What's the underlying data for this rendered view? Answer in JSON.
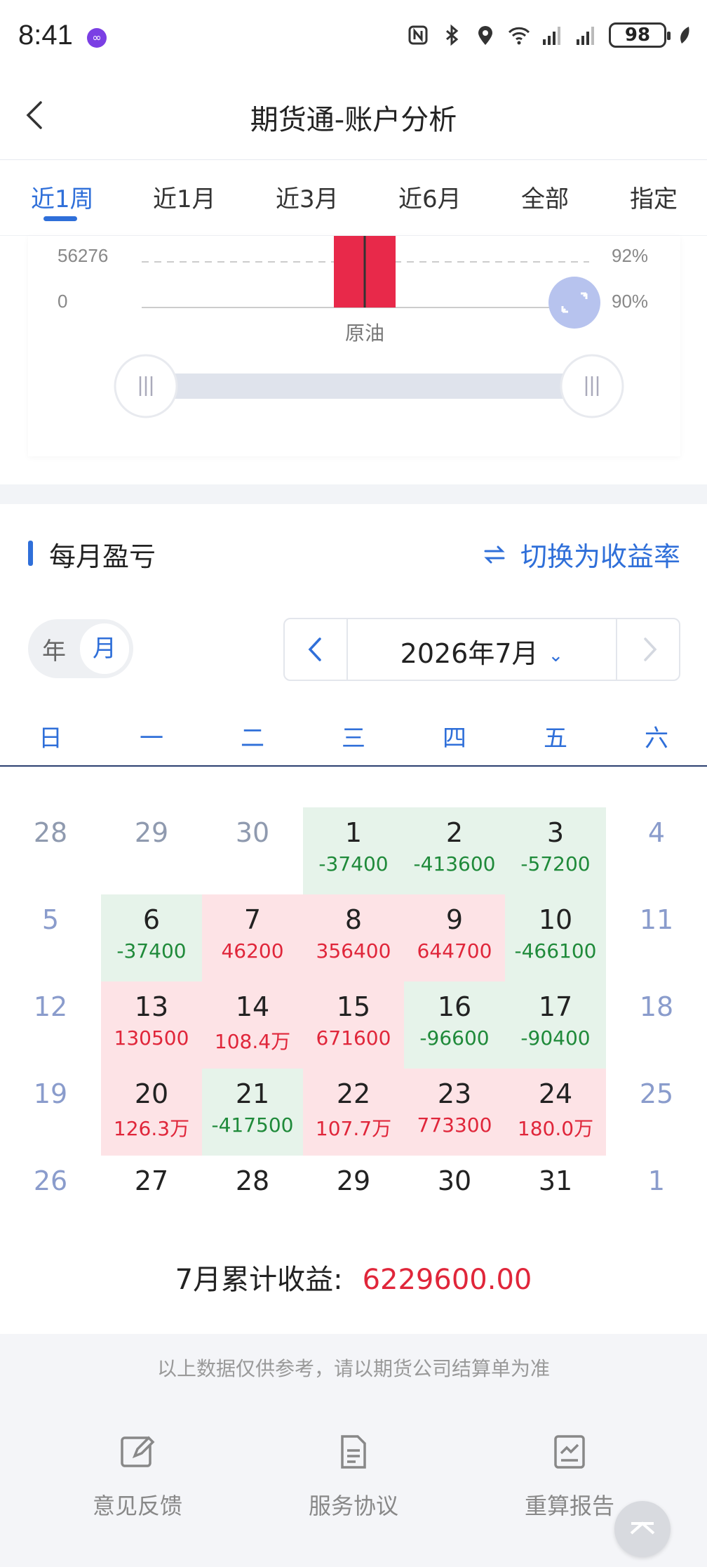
{
  "status": {
    "time": "8:41",
    "battery": "98"
  },
  "nav": {
    "title": "期货通-账户分析"
  },
  "tabs": [
    {
      "label": "近1周",
      "active": true
    },
    {
      "label": "近1月"
    },
    {
      "label": "近3月"
    },
    {
      "label": "近6月"
    },
    {
      "label": "全部"
    },
    {
      "label": "指定"
    }
  ],
  "chart": {
    "left_ticks": [
      "56276",
      "0"
    ],
    "right_ticks": [
      "92%",
      "90%"
    ],
    "category": "原油",
    "bar_color": "#e8294a"
  },
  "section": {
    "title": "每月盈亏",
    "switch_label": "切换为收益率"
  },
  "toggle": {
    "year": "年",
    "month": "月"
  },
  "picker": {
    "label": "2026年7月"
  },
  "weekdays": [
    "日",
    "一",
    "二",
    "三",
    "四",
    "五",
    "六"
  ],
  "calendar": [
    [
      {
        "day": "28",
        "pl": "",
        "type": "dim"
      },
      {
        "day": "29",
        "pl": "",
        "type": "dim"
      },
      {
        "day": "30",
        "pl": "",
        "type": "dim"
      },
      {
        "day": "1",
        "pl": "-37400",
        "type": "loss"
      },
      {
        "day": "2",
        "pl": "-413600",
        "type": "loss"
      },
      {
        "day": "3",
        "pl": "-57200",
        "type": "loss"
      },
      {
        "day": "4",
        "pl": "",
        "type": "wkend"
      }
    ],
    [
      {
        "day": "5",
        "pl": "",
        "type": "wkend"
      },
      {
        "day": "6",
        "pl": "-37400",
        "type": "loss"
      },
      {
        "day": "7",
        "pl": "46200",
        "type": "gain"
      },
      {
        "day": "8",
        "pl": "356400",
        "type": "gain"
      },
      {
        "day": "9",
        "pl": "644700",
        "type": "gain"
      },
      {
        "day": "10",
        "pl": "-466100",
        "type": "loss"
      },
      {
        "day": "11",
        "pl": "",
        "type": "wkend"
      }
    ],
    [
      {
        "day": "12",
        "pl": "",
        "type": "wkend"
      },
      {
        "day": "13",
        "pl": "130500",
        "type": "gain"
      },
      {
        "day": "14",
        "pl": "108.4万",
        "type": "gain"
      },
      {
        "day": "15",
        "pl": "671600",
        "type": "gain"
      },
      {
        "day": "16",
        "pl": "-96600",
        "type": "loss"
      },
      {
        "day": "17",
        "pl": "-90400",
        "type": "loss"
      },
      {
        "day": "18",
        "pl": "",
        "type": "wkend"
      }
    ],
    [
      {
        "day": "19",
        "pl": "",
        "type": "wkend"
      },
      {
        "day": "20",
        "pl": "126.3万",
        "type": "gain"
      },
      {
        "day": "21",
        "pl": "-417500",
        "type": "loss"
      },
      {
        "day": "22",
        "pl": "107.7万",
        "type": "gain"
      },
      {
        "day": "23",
        "pl": "773300",
        "type": "gain"
      },
      {
        "day": "24",
        "pl": "180.0万",
        "type": "gain"
      },
      {
        "day": "25",
        "pl": "",
        "type": "wkend"
      }
    ],
    [
      {
        "day": "26",
        "pl": "",
        "type": "wkend"
      },
      {
        "day": "27",
        "pl": "",
        "type": "plain"
      },
      {
        "day": "28",
        "pl": "",
        "type": "plain"
      },
      {
        "day": "29",
        "pl": "",
        "type": "plain"
      },
      {
        "day": "30",
        "pl": "",
        "type": "plain"
      },
      {
        "day": "31",
        "pl": "",
        "type": "plain"
      },
      {
        "day": "1",
        "pl": "",
        "type": "wkend"
      }
    ]
  ],
  "total": {
    "label": "7月累计收益:",
    "value": "6229600.00"
  },
  "footer": {
    "note": "以上数据仅供参考，请以期货公司结算单为准",
    "items": [
      {
        "label": "意见反馈",
        "icon": "edit-icon"
      },
      {
        "label": "服务协议",
        "icon": "document-icon"
      },
      {
        "label": "重算报告",
        "icon": "report-chart-icon"
      }
    ]
  }
}
